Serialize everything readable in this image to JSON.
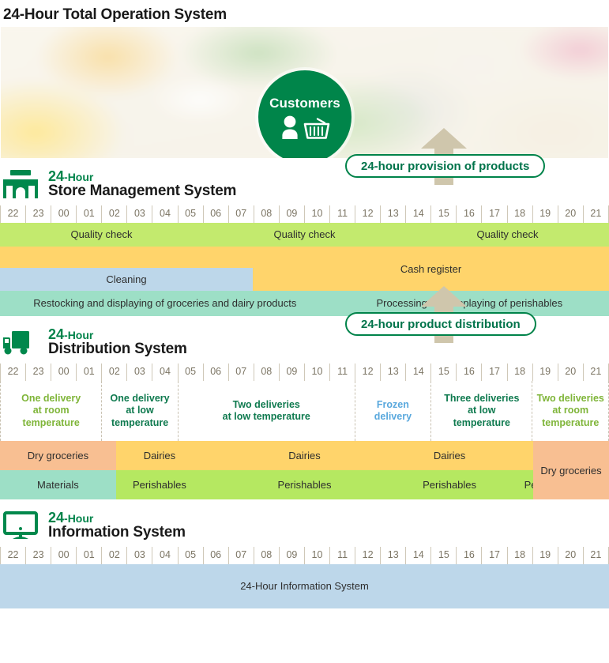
{
  "page_title": "24-Hour Total Operation System",
  "hero": {
    "badge_label": "Customers",
    "person_icon": "person-icon",
    "basket_icon": "shopping-basket-icon"
  },
  "hours": [
    "22",
    "23",
    "00",
    "01",
    "02",
    "03",
    "04",
    "05",
    "06",
    "07",
    "08",
    "09",
    "10",
    "11",
    "12",
    "13",
    "14",
    "15",
    "16",
    "17",
    "18",
    "19",
    "20",
    "21"
  ],
  "colors": {
    "brand_green": "#00834a",
    "quality_green": "#c3ea6e",
    "cash_amber": "#ffd46b",
    "cleaning_blue": "#bdd7ea",
    "restock_mint": "#9ddfc6",
    "peach": "#f8bf92",
    "lime": "#b5e861",
    "arrow_tan": "#cfc6ac",
    "hour_text": "#7c7564",
    "room_temp_text": "#7fb539",
    "low_temp_text": "#0f7a4f",
    "frozen_text": "#59a8dd"
  },
  "store_system": {
    "icon": "store-building-icon",
    "kicker_number": "24",
    "kicker_suffix": "-Hour",
    "name": "Store Management System",
    "callout": {
      "text": "24-hour provision of products",
      "arrow": "arrow-up-icon"
    },
    "quality_row": [
      {
        "label": "Quality check",
        "span": 8
      },
      {
        "label": "Quality check",
        "span": 8
      },
      {
        "label": "Quality check",
        "span": 8
      }
    ],
    "cash_register_label": "Cash register",
    "cleaning_label": "Cleaning",
    "restock_row": [
      {
        "label": "Restocking and displaying of groceries and dairy products",
        "span": 13
      },
      {
        "label": "Processing and displaying of perishables",
        "span": 11
      }
    ]
  },
  "distribution_system": {
    "icon": "delivery-truck-icon",
    "kicker_number": "24",
    "kicker_suffix": "-Hour",
    "name": "Distribution System",
    "callout": {
      "text": "24-hour product distribution",
      "arrow": "arrow-up-icon"
    },
    "delivery_row": [
      {
        "label": "One delivery\nat room\ntemperature",
        "span": 4,
        "tone": "room"
      },
      {
        "label": "One delivery\nat low\ntemperature",
        "span": 3,
        "tone": "low"
      },
      {
        "label": "Two deliveries\nat low temperature",
        "span": 7,
        "tone": "low"
      },
      {
        "label": "Frozen\ndelivery",
        "span": 3,
        "tone": "frozen"
      },
      {
        "label": "Three deliveries\nat low\ntemperature",
        "span": 4,
        "tone": "low"
      },
      {
        "label": "Two deliveries\nat room\ntemperature",
        "span": 3,
        "tone": "room"
      }
    ],
    "dairy_row": [
      {
        "label": "Dry groceries",
        "span": 4,
        "bg": "bg-peach"
      },
      {
        "label": "Dairies",
        "span": 3,
        "bg": "bg-amber"
      },
      {
        "label": "Dairies",
        "span": 7,
        "bg": "bg-amber"
      },
      {
        "label": "Dairies",
        "span": 3,
        "bg": "bg-amber"
      },
      {
        "label": "Dairies",
        "span": 4,
        "bg": "bg-amber"
      }
    ],
    "perishable_row": [
      {
        "label": "Materials",
        "span": 4,
        "bg": "bg-mint"
      },
      {
        "label": "Perishables",
        "span": 3,
        "bg": "bg-lime"
      },
      {
        "label": "Perishables",
        "span": 7,
        "bg": "bg-lime"
      },
      {
        "label": "Perishables",
        "span": 3,
        "bg": "bg-lime"
      },
      {
        "label": "Perishables",
        "span": 4,
        "bg": "bg-lime"
      }
    ],
    "tail_label": "Dry groceries"
  },
  "information_system": {
    "icon": "monitor-icon",
    "kicker_number": "24",
    "kicker_suffix": "-Hour",
    "name": "Information System",
    "bar_label": "24-Hour Information System"
  }
}
